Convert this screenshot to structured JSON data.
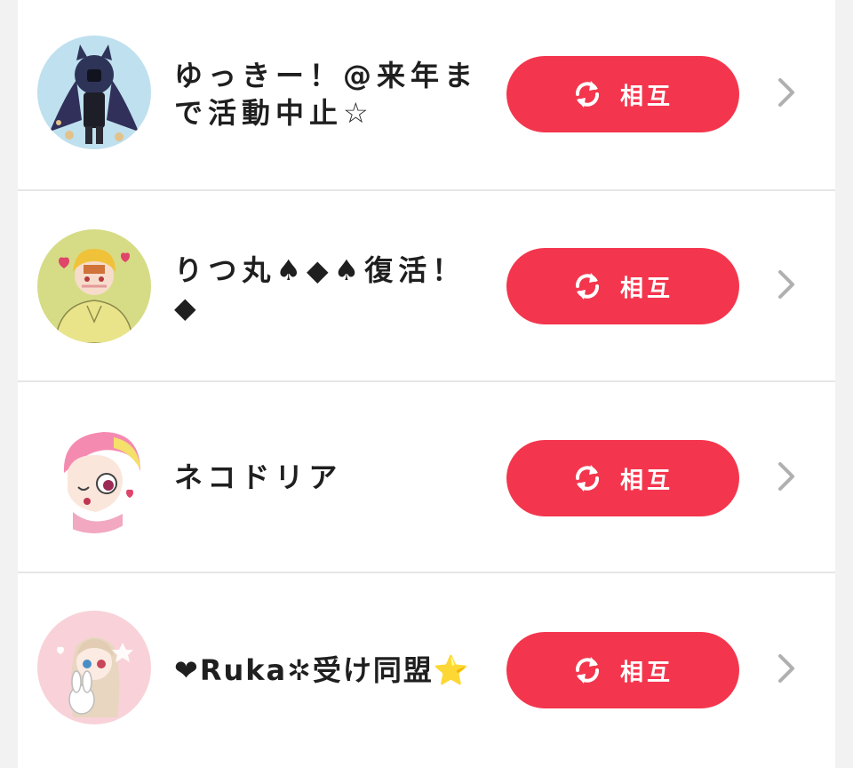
{
  "colors": {
    "button_bg": "#f3364d",
    "button_text": "#ffffff",
    "name_text": "#1f1f1f",
    "chevron": "#b0b0b0",
    "divider": "#e6e6e6"
  },
  "rows": [
    {
      "name": "ゆっきー！@来年まで活動中止☆",
      "button_label": "相互",
      "button_icon": "refresh-icon",
      "chevron_icon": "chevron-right-icon",
      "avatar": "user-avatar"
    },
    {
      "name": "りつ丸♠◆♠復活！◆",
      "button_label": "相互",
      "button_icon": "refresh-icon",
      "chevron_icon": "chevron-right-icon",
      "avatar": "user-avatar"
    },
    {
      "name": "ネコドリア",
      "button_label": "相互",
      "button_icon": "refresh-icon",
      "chevron_icon": "chevron-right-icon",
      "avatar": "user-avatar"
    },
    {
      "name": "❤Ruka✲受け同盟⭐",
      "button_label": "相互",
      "button_icon": "refresh-icon",
      "chevron_icon": "chevron-right-icon",
      "avatar": "user-avatar"
    }
  ]
}
